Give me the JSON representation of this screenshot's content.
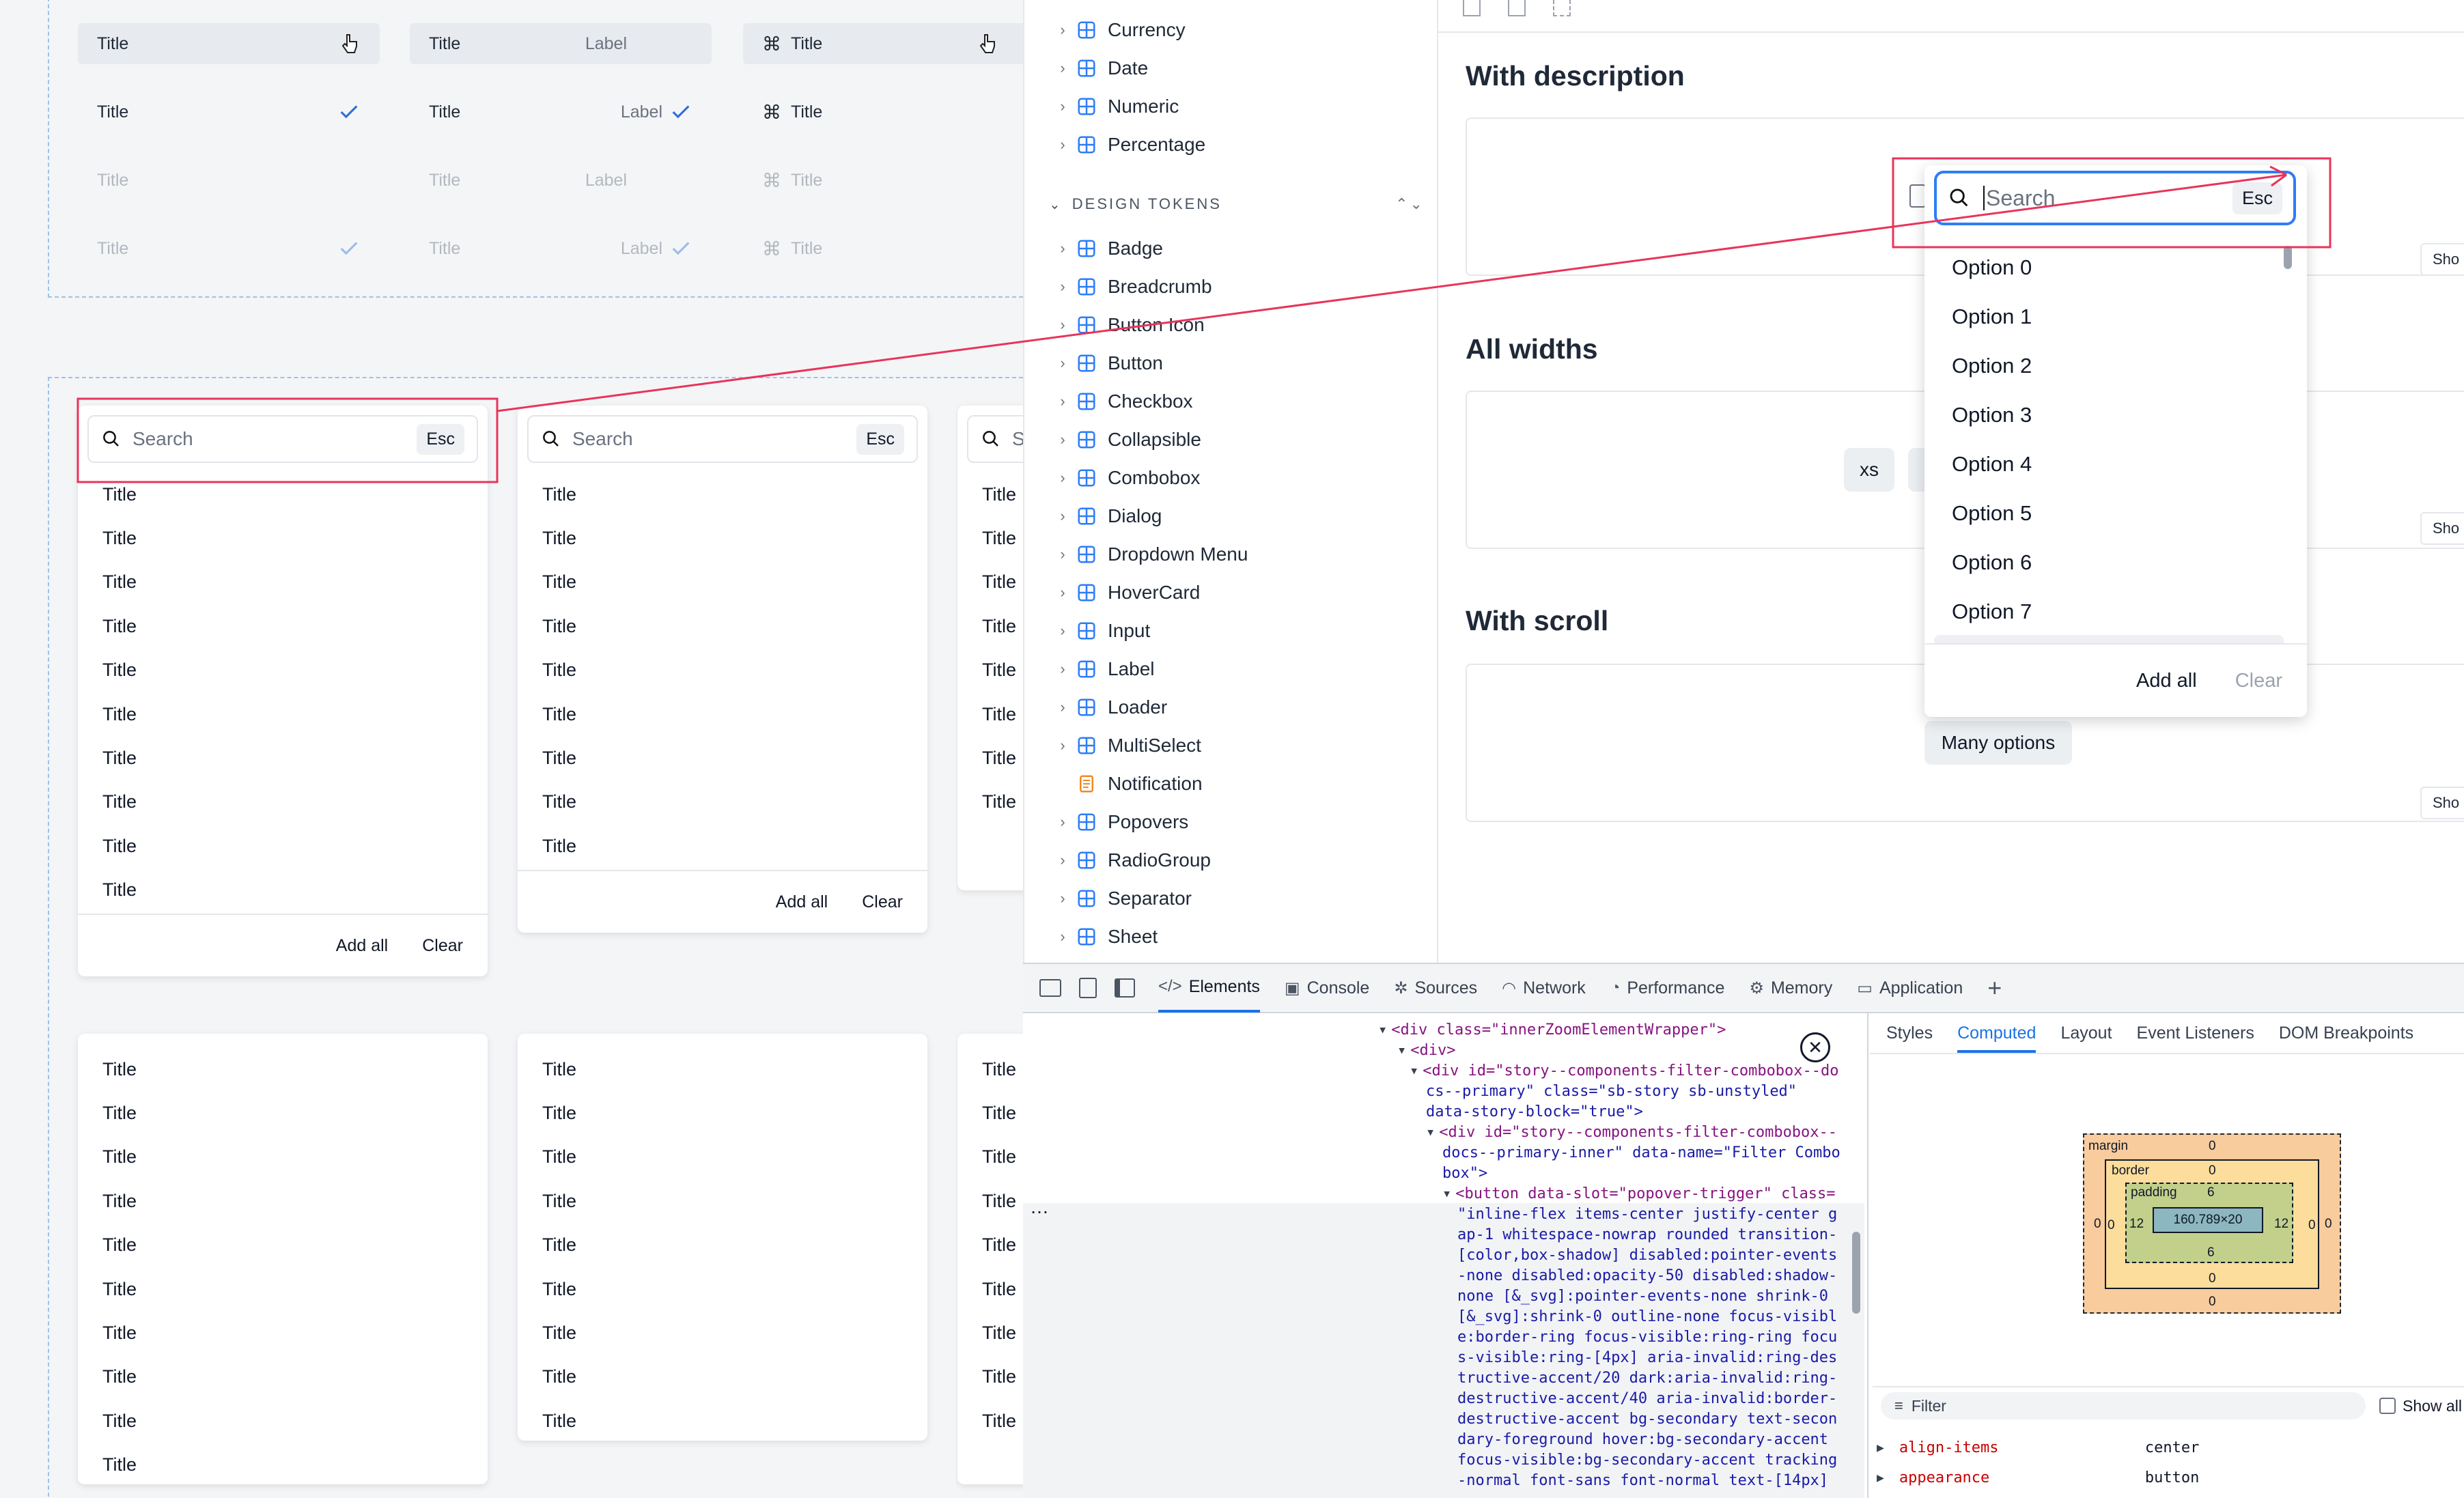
{
  "canvas": {
    "menu_rows": [
      {
        "title": "Title",
        "label": "Label",
        "cmd": true,
        "checked": false
      },
      {
        "title": "Title",
        "label": "Label",
        "checked": true
      },
      {
        "title": "Title",
        "label": "Label",
        "checked": false
      },
      {
        "title": "Title",
        "label": "Label",
        "checked": true
      }
    ],
    "search_card": {
      "placeholder": "Search",
      "esc": "Esc",
      "item": "Title",
      "add_all": "Add all",
      "clear": "Clear"
    }
  },
  "sidebar": {
    "items_top": [
      "Currency",
      "Date",
      "Numeric",
      "Percentage"
    ],
    "section": "DESIGN TOKENS",
    "items": [
      "Badge",
      "Breadcrumb",
      "Button Icon",
      "Button",
      "Checkbox",
      "Collapsible",
      "Combobox",
      "Dialog",
      "Dropdown Menu",
      "HoverCard",
      "Input",
      "Label",
      "Loader",
      "MultiSelect",
      "Notification",
      "Popovers",
      "RadioGroup",
      "Separator",
      "Sheet"
    ]
  },
  "preview": {
    "with_description": "With description",
    "all_widths": "All widths",
    "with_scroll": "With scroll",
    "chip_xs": "xs",
    "many_options": "Many options",
    "show": "Sho",
    "popover": {
      "placeholder": "Search",
      "esc": "Esc",
      "options": [
        "Option 0",
        "Option 1",
        "Option 2",
        "Option 3",
        "Option 4",
        "Option 5",
        "Option 6",
        "Option 7"
      ],
      "add_all": "Add all",
      "clear": "Clear"
    }
  },
  "devtools": {
    "tabs": [
      "Elements",
      "Console",
      "Sources",
      "Network",
      "Performance",
      "Memory",
      "Application"
    ],
    "side_tabs": [
      "Styles",
      "Computed",
      "Layout",
      "Event Listeners",
      "DOM Breakpoints"
    ],
    "box_model": {
      "margin": "margin",
      "border": "border",
      "padding": "padding",
      "margin_top": "0",
      "border_top": "0",
      "padding_top": "6",
      "content": "160.789×20",
      "left_a": "0",
      "left_b": "0",
      "left_c": "12",
      "right_c": "12",
      "right_b": "0",
      "right_a": "0",
      "padding_bottom": "6",
      "border_bottom": "0",
      "margin_bottom": "0"
    },
    "filter": "Filter",
    "show_all": "Show all",
    "props": [
      {
        "name": "align-items",
        "value": "center"
      },
      {
        "name": "appearance",
        "value": "button"
      },
      {
        "name": "background-color",
        "value": ""
      }
    ],
    "code_lines": [
      "<div class=\"innerZoomElementWrapper\">",
      "<div>",
      "<div id=\"story--components-filter-combobox--do",
      "cs--primary\" class=\"sb-story sb-unstyled\"",
      "data-story-block=\"true\">",
      "<div id=\"story--components-filter-combobox--",
      "docs--primary-inner\" data-name=\"Filter Combo",
      "box\">",
      "<button data-slot=\"popover-trigger\" class=",
      "\"inline-flex items-center justify-center g",
      "ap-1 whitespace-nowrap rounded transition-",
      "[color,box-shadow] disabled:pointer-events",
      "-none disabled:opacity-50 disabled:shadow-",
      "none [&_svg]:pointer-events-none shrink-0",
      "[&_svg]:shrink-0 outline-none focus-visibl",
      "e:border-ring focus-visible:ring-ring focu",
      "s-visible:ring-[4px] aria-invalid:ring-des",
      "tructive-accent/20 dark:aria-invalid:ring-",
      "destructive-accent/40 aria-invalid:border-",
      "destructive-accent bg-secondary text-secon",
      "dary-foreground hover:bg-secondary-accent",
      "focus-visible:bg-secondary-accent tracking",
      "-normal font-sans font-normal text-[14px]"
    ]
  },
  "colors": {
    "accent": "#2e7df6",
    "annotation": "#e8345a",
    "check": "#2e6fd8"
  }
}
